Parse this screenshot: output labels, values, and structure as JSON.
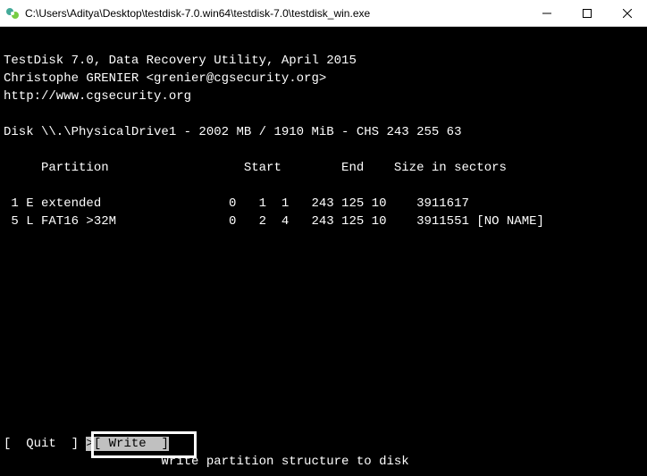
{
  "titlebar": {
    "path": "C:\\Users\\Aditya\\Desktop\\testdisk-7.0.win64\\testdisk-7.0\\testdisk_win.exe"
  },
  "console": {
    "header1": "TestDisk 7.0, Data Recovery Utility, April 2015",
    "header2": "Christophe GRENIER <grenier@cgsecurity.org>",
    "header3": "http://www.cgsecurity.org",
    "disk_line": "Disk \\\\.\\PhysicalDrive1 - 2002 MB / 1910 MiB - CHS 243 255 63",
    "col_header": "     Partition                  Start        End    Size in sectors",
    "rows": [
      " 1 E extended                 0   1  1   243 125 10    3911617",
      " 5 L FAT16 >32M               0   2  4   243 125 10    3911551 [NO NAME]"
    ]
  },
  "menu": {
    "left_bracket": "[  ",
    "quit_label": "Quit",
    "mid": "  ] ",
    "sel_prefix": ">",
    "write_open": "[ ",
    "write_label": "Write",
    "write_close": "  ]",
    "hint": "                     Write partition structure to disk"
  }
}
